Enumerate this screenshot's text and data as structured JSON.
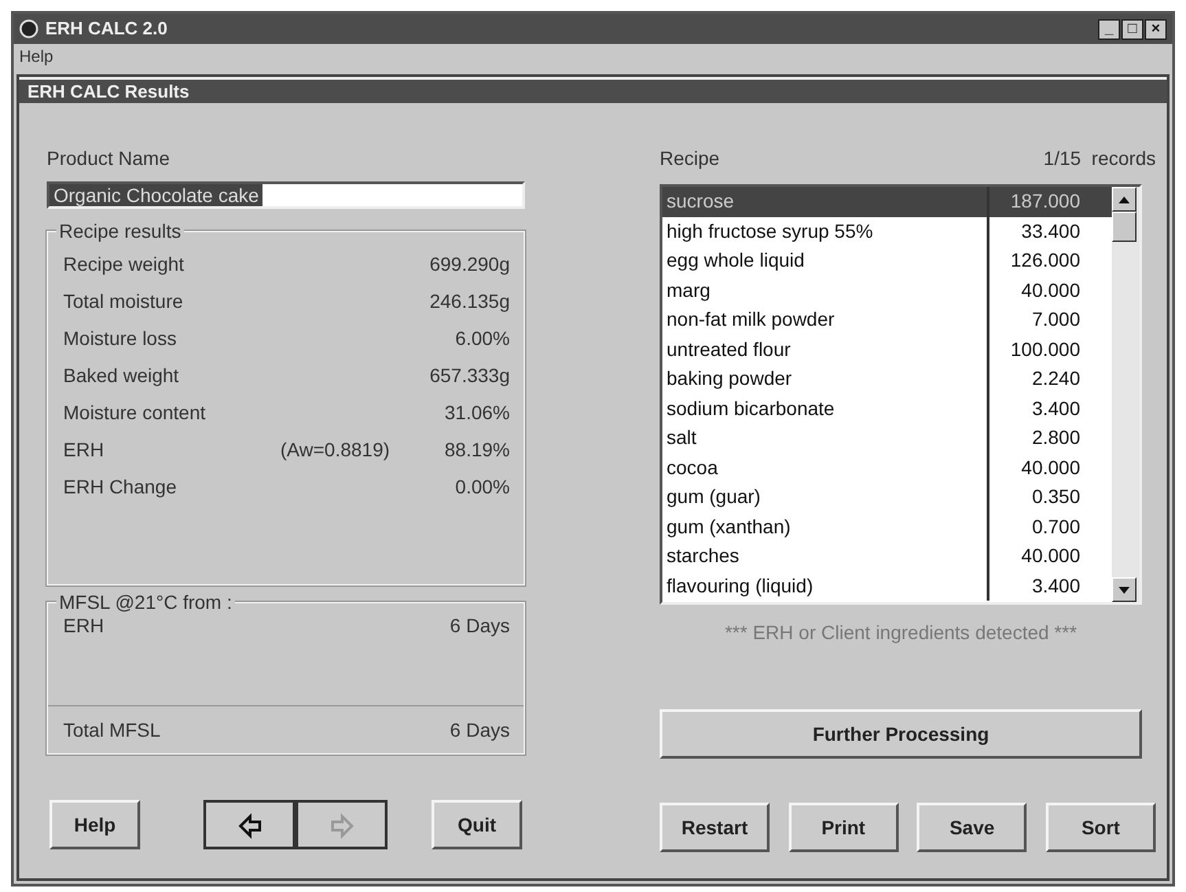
{
  "window": {
    "title": "ERH CALC 2.0",
    "controls": [
      "_",
      "□",
      "×"
    ]
  },
  "menu": [
    {
      "label": "Help"
    }
  ],
  "panel": {
    "title": "ERH CALC Results"
  },
  "product": {
    "label": "Product Name",
    "value": "Organic Chocolate cake",
    "selected": true
  },
  "recipe_results": {
    "title": "Recipe results",
    "rows": [
      {
        "label": "Recipe weight",
        "value": "699.290g"
      },
      {
        "label": "Total moisture",
        "value": "246.135g"
      },
      {
        "label": "Moisture loss",
        "value": "6.00%"
      },
      {
        "label": "Baked weight",
        "value": "657.333g"
      },
      {
        "label": "Moisture content",
        "value": "31.06%"
      },
      {
        "label": "ERH",
        "note": "(Aw=0.8819)",
        "value": "88.19%"
      },
      {
        "label": "ERH Change",
        "value": "0.00%"
      }
    ]
  },
  "mfsl": {
    "title": "MFSL  @21°C from :",
    "rows": [
      {
        "label": "ERH",
        "value": "6 Days"
      }
    ],
    "total": {
      "label": "Total MFSL",
      "value": "6 Days"
    }
  },
  "recipe": {
    "label": "Recipe",
    "count": "1/15",
    "count_unit": "records",
    "items": [
      {
        "name": "sucrose",
        "amount": "187.000",
        "selected": true
      },
      {
        "name": "high fructose syrup 55%",
        "amount": "33.400",
        "selected": false
      },
      {
        "name": "egg whole liquid",
        "amount": "126.000",
        "selected": false
      },
      {
        "name": "marg",
        "amount": "40.000",
        "selected": false
      },
      {
        "name": "non-fat milk powder",
        "amount": "7.000",
        "selected": false
      },
      {
        "name": "untreated flour",
        "amount": "100.000",
        "selected": false
      },
      {
        "name": "baking powder",
        "amount": "2.240",
        "selected": false
      },
      {
        "name": "sodium bicarbonate",
        "amount": "3.400",
        "selected": false
      },
      {
        "name": "salt",
        "amount": "2.800",
        "selected": false
      },
      {
        "name": "cocoa",
        "amount": "40.000",
        "selected": false
      },
      {
        "name": "gum (guar)",
        "amount": "0.350",
        "selected": false
      },
      {
        "name": "gum (xanthan)",
        "amount": "0.700",
        "selected": false
      },
      {
        "name": "starches",
        "amount": "40.000",
        "selected": false
      },
      {
        "name": "flavouring (liquid)",
        "amount": "3.400",
        "selected": false
      }
    ],
    "note": "*** ERH or Client ingredients detected ***"
  },
  "further_button": "Further Processing",
  "left_buttons": [
    {
      "label": "Help",
      "kind": "text"
    },
    {
      "kind": "arrow-left",
      "disabled": false
    },
    {
      "kind": "arrow-right",
      "disabled": true
    },
    {
      "label": "Quit",
      "kind": "text"
    }
  ],
  "right_buttons": [
    {
      "label": "Restart"
    },
    {
      "label": "Print"
    },
    {
      "label": "Save"
    },
    {
      "label": "Sort"
    }
  ]
}
